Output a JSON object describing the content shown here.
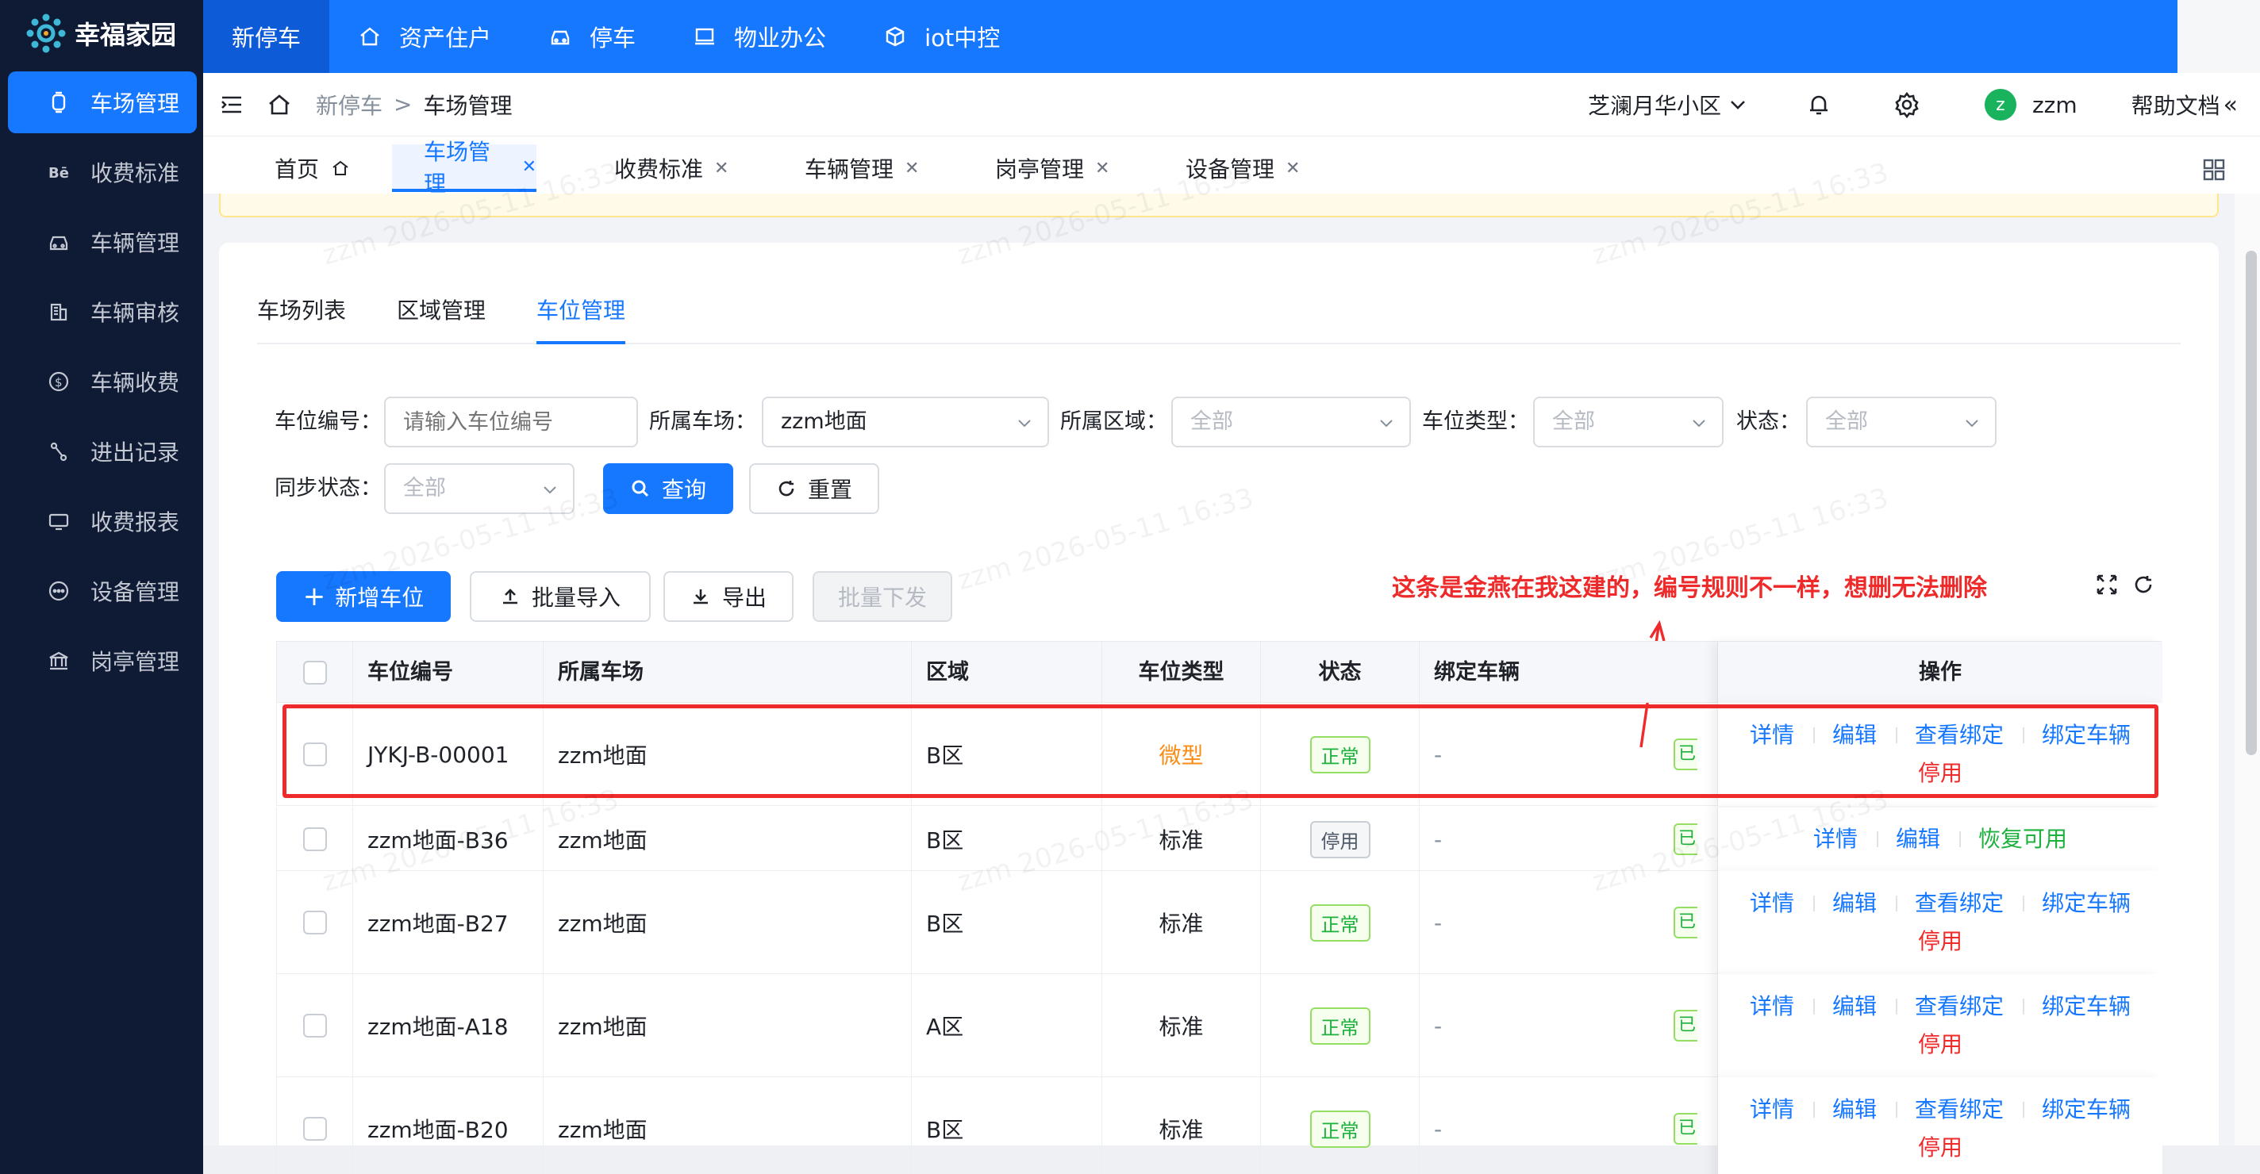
{
  "brand": {
    "name": "幸福家园"
  },
  "sidebar": {
    "items": [
      {
        "label": "车场管理",
        "icon": "parking-icon",
        "active": true
      },
      {
        "label": "收费标准",
        "icon": "behance-icon",
        "active": false
      },
      {
        "label": "车辆管理",
        "icon": "car-icon",
        "active": false
      },
      {
        "label": "车辆审核",
        "icon": "building-icon",
        "active": false
      },
      {
        "label": "车辆收费",
        "icon": "dollar-icon",
        "active": false
      },
      {
        "label": "进出记录",
        "icon": "route-icon",
        "active": false
      },
      {
        "label": "收费报表",
        "icon": "report-icon",
        "active": false
      },
      {
        "label": "设备管理",
        "icon": "chat-dots-icon",
        "active": false
      },
      {
        "label": "岗亭管理",
        "icon": "bank-icon",
        "active": false
      }
    ]
  },
  "topnav": {
    "items": [
      {
        "label": "新停车",
        "icon": "",
        "active": true
      },
      {
        "label": "资产住户",
        "icon": "home-icon"
      },
      {
        "label": "停车",
        "icon": "car-icon"
      },
      {
        "label": "物业办公",
        "icon": "monitor-icon"
      },
      {
        "label": "iot中控",
        "icon": "cube-icon"
      }
    ]
  },
  "header": {
    "breadcrumb": [
      "新停车",
      "车场管理"
    ],
    "community": "芝澜月华小区",
    "user": {
      "avatar_letter": "z",
      "name": "zzm"
    },
    "help": "帮助文档"
  },
  "tabs": [
    {
      "label": "首页",
      "active": false
    },
    {
      "label": "车场管理",
      "active": true
    },
    {
      "label": "收费标准",
      "active": false
    },
    {
      "label": "车辆管理",
      "active": false
    },
    {
      "label": "岗亭管理",
      "active": false
    },
    {
      "label": "设备管理",
      "active": false
    }
  ],
  "subtabs": [
    {
      "label": "车场列表",
      "active": false
    },
    {
      "label": "区域管理",
      "active": false
    },
    {
      "label": "车位管理",
      "active": true
    }
  ],
  "filters": {
    "space_no": {
      "label": "车位编号：",
      "placeholder": "请输入车位编号"
    },
    "lot": {
      "label": "所属车场：",
      "value": "zzm地面"
    },
    "area": {
      "label": "所属区域：",
      "value": "全部"
    },
    "type": {
      "label": "车位类型：",
      "value": "全部"
    },
    "status": {
      "label": "状态：",
      "value": "全部"
    },
    "sync": {
      "label": "同步状态：",
      "value": "全部"
    },
    "query": "查询",
    "reset": "重置"
  },
  "toolbar": {
    "add": "新增车位",
    "import": "批量导入",
    "export": "导出",
    "batch_issue": "批量下发"
  },
  "annotation": "这条是金燕在我这建的，编号规则不一样，想删无法删除",
  "table": {
    "columns": [
      "车位编号",
      "所属车场",
      "区域",
      "车位类型",
      "状态",
      "绑定车辆",
      "操作"
    ],
    "rows": [
      {
        "code": "JYKJ-B-00001",
        "lot": "zzm地面",
        "area": "B区",
        "type": "微型",
        "status": "正常",
        "bound": "-",
        "sync": "已",
        "ops": [
          "详情",
          "编辑",
          "查看绑定",
          "绑定车辆",
          "停用"
        ]
      },
      {
        "code": "zzm地面-B36",
        "lot": "zzm地面",
        "area": "B区",
        "type": "标准",
        "status": "停用",
        "bound": "-",
        "sync": "已",
        "ops": [
          "详情",
          "编辑",
          "恢复可用"
        ]
      },
      {
        "code": "zzm地面-B27",
        "lot": "zzm地面",
        "area": "B区",
        "type": "标准",
        "status": "正常",
        "bound": "-",
        "sync": "已",
        "ops": [
          "详情",
          "编辑",
          "查看绑定",
          "绑定车辆",
          "停用"
        ]
      },
      {
        "code": "zzm地面-A18",
        "lot": "zzm地面",
        "area": "A区",
        "type": "标准",
        "status": "正常",
        "bound": "-",
        "sync": "已",
        "ops": [
          "详情",
          "编辑",
          "查看绑定",
          "绑定车辆",
          "停用"
        ]
      },
      {
        "code": "zzm地面-B20",
        "lot": "zzm地面",
        "area": "B区",
        "type": "标准",
        "status": "正常",
        "bound": "-",
        "sync": "已",
        "ops": [
          "详情",
          "编辑",
          "查看绑定",
          "绑定车辆",
          "停用"
        ]
      }
    ]
  },
  "watermark": "zzm 2026-05-11 16:33",
  "colors": {
    "primary": "#1677ff",
    "sidebar": "#0f1b34",
    "danger": "#ee2a2a",
    "success": "#1bb13c",
    "warning": "#fa8c16"
  }
}
